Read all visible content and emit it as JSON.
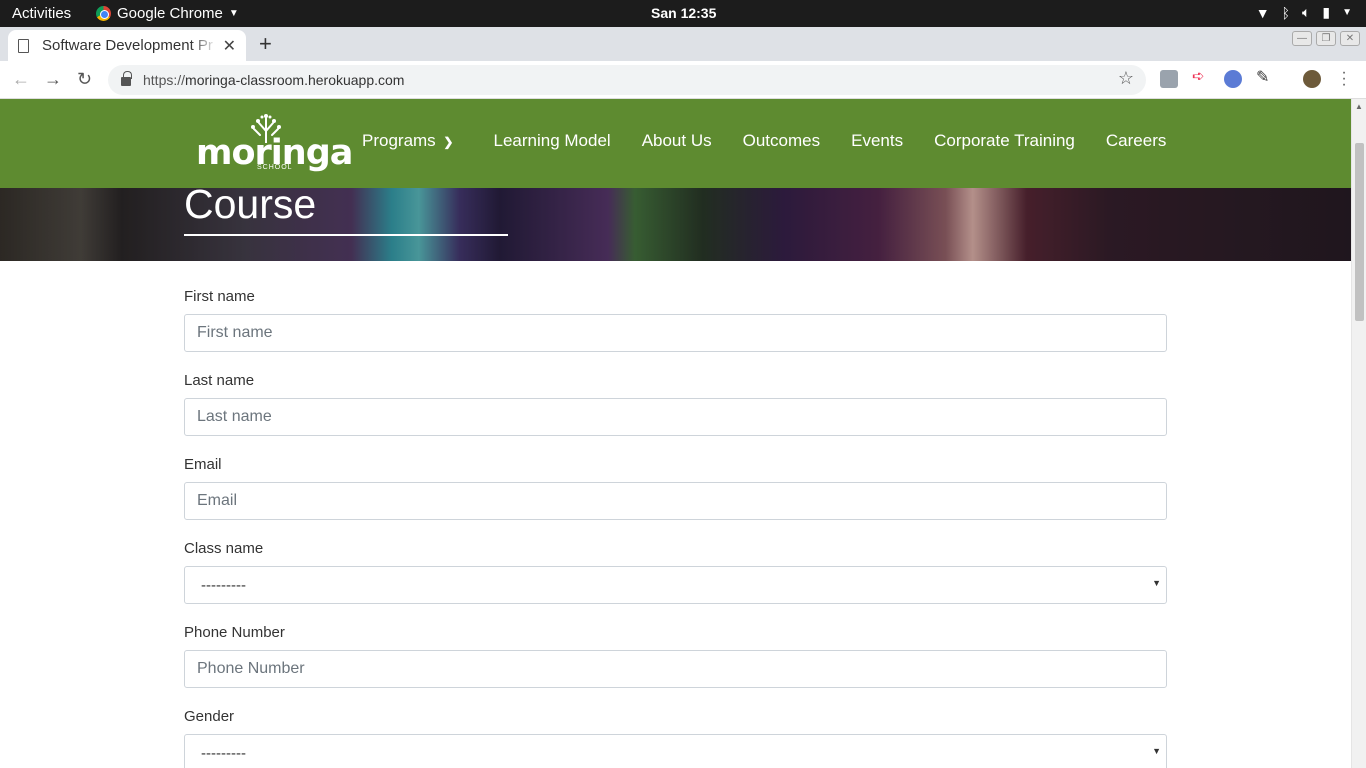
{
  "system": {
    "activities": "Activities",
    "app_name": "Google Chrome",
    "clock": "San 12:35"
  },
  "browser": {
    "tab_title": "Software Development Pr",
    "url_scheme": "https://",
    "url_host": "moringa-classroom.herokuapp.com"
  },
  "site": {
    "logo_text": "moringa",
    "logo_sub": "SCHOOL",
    "nav": [
      {
        "label": "Programs"
      },
      {
        "label": "Learning Model"
      },
      {
        "label": "About Us"
      },
      {
        "label": "Outcomes"
      },
      {
        "label": "Events"
      },
      {
        "label": "Corporate Training"
      },
      {
        "label": "Careers"
      }
    ],
    "hero_title": "Course"
  },
  "form": {
    "first_name": {
      "label": "First name",
      "placeholder": "First name"
    },
    "last_name": {
      "label": "Last name",
      "placeholder": "Last name"
    },
    "email": {
      "label": "Email",
      "placeholder": "Email"
    },
    "class_name": {
      "label": "Class name",
      "value": "---------"
    },
    "phone": {
      "label": "Phone Number",
      "placeholder": "Phone Number"
    },
    "gender": {
      "label": "Gender",
      "value": "---------"
    }
  },
  "colors": {
    "nav_green": "#5e8b30"
  }
}
